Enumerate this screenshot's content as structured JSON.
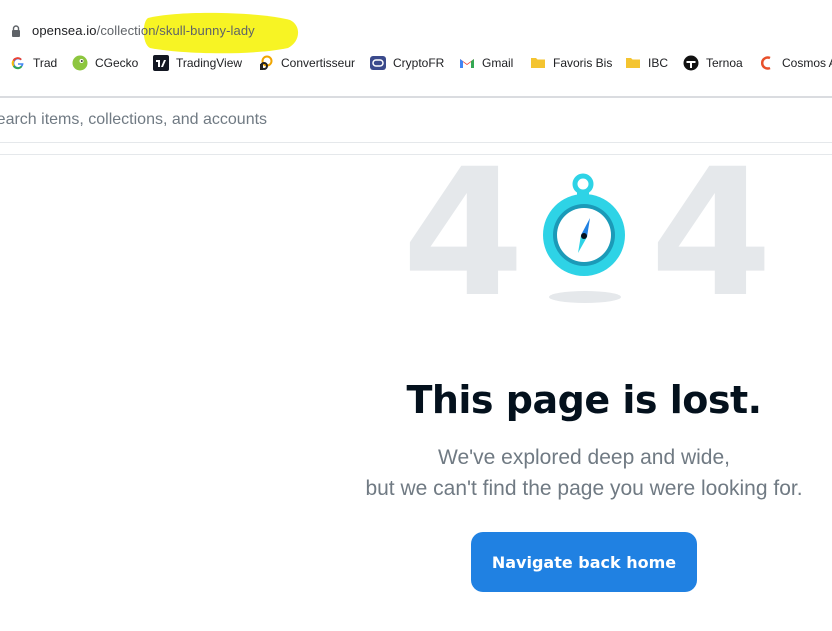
{
  "browser": {
    "url_domain": "opensea.io",
    "url_path": "/collection/skull-bunny-lady",
    "highlight_color": "#f7f318"
  },
  "bookmarks": [
    {
      "label": "Trad",
      "icon": "google-icon"
    },
    {
      "label": "CGecko",
      "icon": "coingecko-icon"
    },
    {
      "label": "TradingView",
      "icon": "tradingview-icon"
    },
    {
      "label": "Convertisseur",
      "icon": "converter-icon"
    },
    {
      "label": "CryptoFR",
      "icon": "cryptofr-icon"
    },
    {
      "label": "Gmail",
      "icon": "gmail-icon"
    },
    {
      "label": "Favoris Bis",
      "icon": "folder-icon"
    },
    {
      "label": "IBC",
      "icon": "folder-icon"
    },
    {
      "label": "Ternoa",
      "icon": "ternoa-icon"
    },
    {
      "label": "Cosmos A",
      "icon": "cosmos-icon"
    }
  ],
  "search": {
    "placeholder": "Search items, collections, and accounts"
  },
  "error": {
    "code_left": "4",
    "code_right": "4",
    "title": "This page is lost.",
    "line1": "We've explored deep and wide,",
    "line2": "but we can't find the page you were looking for.",
    "button_label": "Navigate back home"
  },
  "colors": {
    "accent": "#2081e2",
    "digit": "#e5e8eb",
    "compass": "#2ed3e6",
    "title": "#04111d",
    "muted": "#707a83"
  }
}
